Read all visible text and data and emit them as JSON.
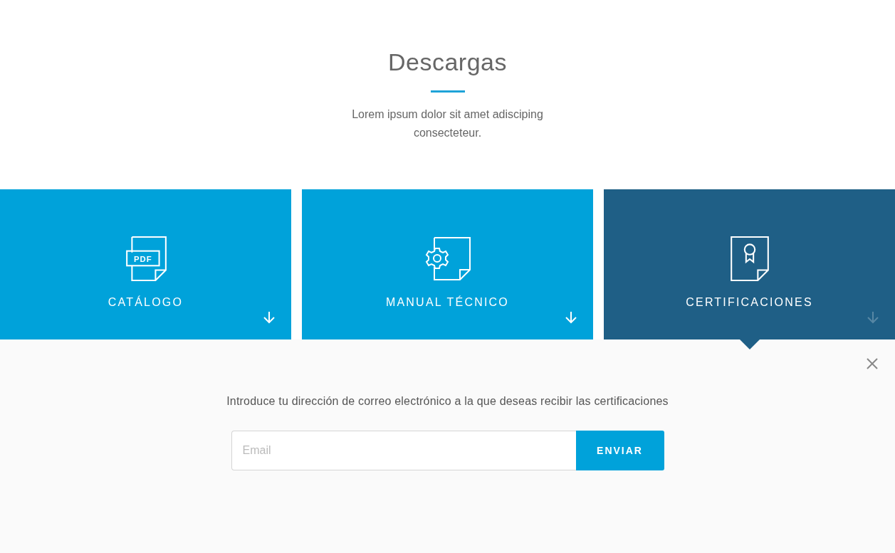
{
  "header": {
    "title": "Descargas",
    "subtitle": "Lorem ipsum dolor sit amet adisciping consecteteur."
  },
  "cards": [
    {
      "kind": "pdf",
      "icon_text": "PDF",
      "label": "CATÁLOGO",
      "selected": false
    },
    {
      "kind": "gear",
      "label": "MANUAL TÉCNICO",
      "selected": false
    },
    {
      "kind": "award",
      "label": "CERTIFICACIONES",
      "selected": true
    }
  ],
  "panel": {
    "message": "Introduce tu dirección de correo electrónico a la que deseas recibir las certificaciones",
    "email": {
      "placeholder": "Email"
    },
    "button": "ENVIAR"
  }
}
